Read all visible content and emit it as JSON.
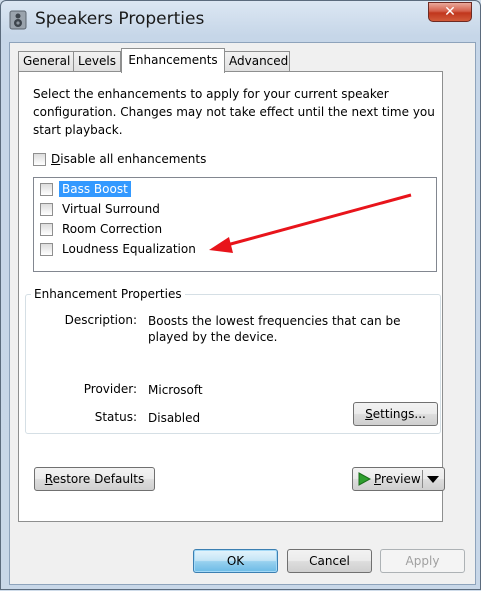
{
  "window": {
    "title": "Speakers Properties",
    "close_glyph": "✕"
  },
  "tabs": [
    {
      "label": "General"
    },
    {
      "label": "Levels"
    },
    {
      "label": "Enhancements",
      "active": true
    },
    {
      "label": "Advanced"
    }
  ],
  "enhancements": {
    "description": "Select the enhancements to apply for your current speaker configuration. Changes may not take effect until the next time you start playback.",
    "disable_all": {
      "label_prefix": "D",
      "label_rest": "isable all enhancements",
      "checked": false
    },
    "items": [
      {
        "label": "Bass Boost",
        "checked": false,
        "selected": true
      },
      {
        "label": "Virtual Surround",
        "checked": false,
        "selected": false
      },
      {
        "label": "Room Correction",
        "checked": false,
        "selected": false
      },
      {
        "label": "Loudness Equalization",
        "checked": false,
        "selected": false
      }
    ]
  },
  "properties": {
    "group_title": "Enhancement Properties",
    "description_label": "Description:",
    "description_value": "Boosts the lowest frequencies that can be played by the device.",
    "provider_label": "Provider:",
    "provider_value": "Microsoft",
    "status_label": "Status:",
    "status_value": "Disabled",
    "settings_button": {
      "prefix": "S",
      "rest": "ettings..."
    }
  },
  "buttons": {
    "restore_defaults": {
      "prefix": "R",
      "rest": "estore Defaults"
    },
    "preview": {
      "prefix": "P",
      "rest": "review"
    },
    "ok": "OK",
    "cancel": "Cancel",
    "apply": "Apply"
  },
  "colors": {
    "annotation_arrow": "#e8141b",
    "selection": "#3399ff"
  }
}
